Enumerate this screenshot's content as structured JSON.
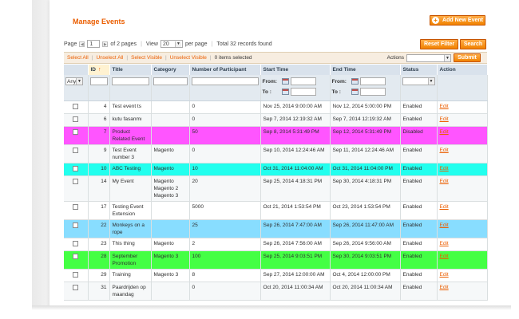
{
  "page": {
    "title": "Manage Events",
    "add_button": "Add New Event",
    "reset_filter": "Reset Filter",
    "search": "Search"
  },
  "pager": {
    "page_label": "Page",
    "current_page": "1",
    "of_pages": "of 2 pages",
    "view_label": "View",
    "per_page": "20",
    "per_page_label": "per page",
    "total": "Total 32 records found"
  },
  "massaction": {
    "select_all": "Select All",
    "unselect_all": "Unselect All",
    "select_visible": "Select Visible",
    "unselect_visible": "Unselect Visible",
    "items_selected": "0 items selected",
    "actions_label": "Actions",
    "submit": "Submit"
  },
  "columns": [
    "",
    "ID",
    "Title",
    "Category",
    "Number of Participant",
    "Start Time",
    "End Time",
    "Status",
    "Action"
  ],
  "filter": {
    "any_option": "Any",
    "from_label": "From:",
    "to_label": "To :"
  },
  "rows": [
    {
      "id": "4",
      "title": "Test event ts",
      "category": "",
      "participants": "0",
      "start": "Nov 25, 2014 9:00:00 AM",
      "end": "Nov 12, 2014 5:00:00 PM",
      "status": "Enabled",
      "action": "Edit",
      "color": ""
    },
    {
      "id": "6",
      "title": "kutu fasanmı",
      "category": "",
      "participants": "0",
      "start": "Sep 7, 2014 12:19:32 AM",
      "end": "Sep 7, 2014 12:19:32 AM",
      "status": "Enabled",
      "action": "Edit",
      "color": ""
    },
    {
      "id": "7",
      "title": "Product Related Event",
      "category": "",
      "participants": "50",
      "start": "Sep 8, 2014 5:31:49 PM",
      "end": "Sep 12, 2014 5:31:49 PM",
      "status": "Disabled",
      "action": "Edit",
      "color": "#ff55ff"
    },
    {
      "id": "9",
      "title": "Test Event number 3",
      "category": "Magento",
      "participants": "0",
      "start": "Sep 10, 2014 12:24:46 AM",
      "end": "Sep 11, 2014 12:24:46 AM",
      "status": "Enabled",
      "action": "Edit",
      "color": ""
    },
    {
      "id": "10",
      "title": "ABC Testing",
      "category": "Magento",
      "participants": "10",
      "start": "Oct 31, 2014 11:04:00 AM",
      "end": "Oct 31, 2014 11:04:00 PM",
      "status": "Enabled",
      "action": "Edit",
      "color": "#22ffee"
    },
    {
      "id": "14",
      "title": "My Event",
      "category": "Magento Magento 2 Magento 3",
      "participants": "20",
      "start": "Sep 25, 2014 4:18:31 PM",
      "end": "Sep 30, 2014 4:18:31 PM",
      "status": "Enabled",
      "action": "Edit",
      "color": ""
    },
    {
      "id": "17",
      "title": "Testing Event Extension",
      "category": "",
      "participants": "5000",
      "start": "Oct 21, 2014 1:53:54 PM",
      "end": "Oct 23, 2014 1:53:54 PM",
      "status": "Enabled",
      "action": "Edit",
      "color": ""
    },
    {
      "id": "22",
      "title": "Monkeys on a rope",
      "category": "",
      "participants": "25",
      "start": "Sep 26, 2014 7:47:00 AM",
      "end": "Sep 26, 2014 11:47:00 AM",
      "status": "Enabled",
      "action": "Edit",
      "color": "#88ddff"
    },
    {
      "id": "23",
      "title": "This thing",
      "category": "Magento",
      "participants": "2",
      "start": "Sep 26, 2014 7:56:00 AM",
      "end": "Sep 26, 2014 9:56:00 AM",
      "status": "Enabled",
      "action": "Edit",
      "color": ""
    },
    {
      "id": "28",
      "title": "September Promotion",
      "category": "Magento 3",
      "participants": "100",
      "start": "Sep 25, 2014 9:03:51 PM",
      "end": "Sep 30, 2014 9:03:51 PM",
      "status": "Enabled",
      "action": "Edit",
      "color": "#44ff44"
    },
    {
      "id": "29",
      "title": "Training",
      "category": "Magento 3",
      "participants": "8",
      "start": "Sep 27, 2014 12:00:00 AM",
      "end": "Oct 4, 2014 12:00:00 PM",
      "status": "Enabled",
      "action": "Edit",
      "color": ""
    },
    {
      "id": "31",
      "title": "Paardrijden op maandag",
      "category": "",
      "participants": "0",
      "start": "Oct 20, 2014 11:00:34 AM",
      "end": "Oct 20, 2014 11:00:34 AM",
      "status": "Enabled",
      "action": "Edit",
      "color": ""
    }
  ]
}
